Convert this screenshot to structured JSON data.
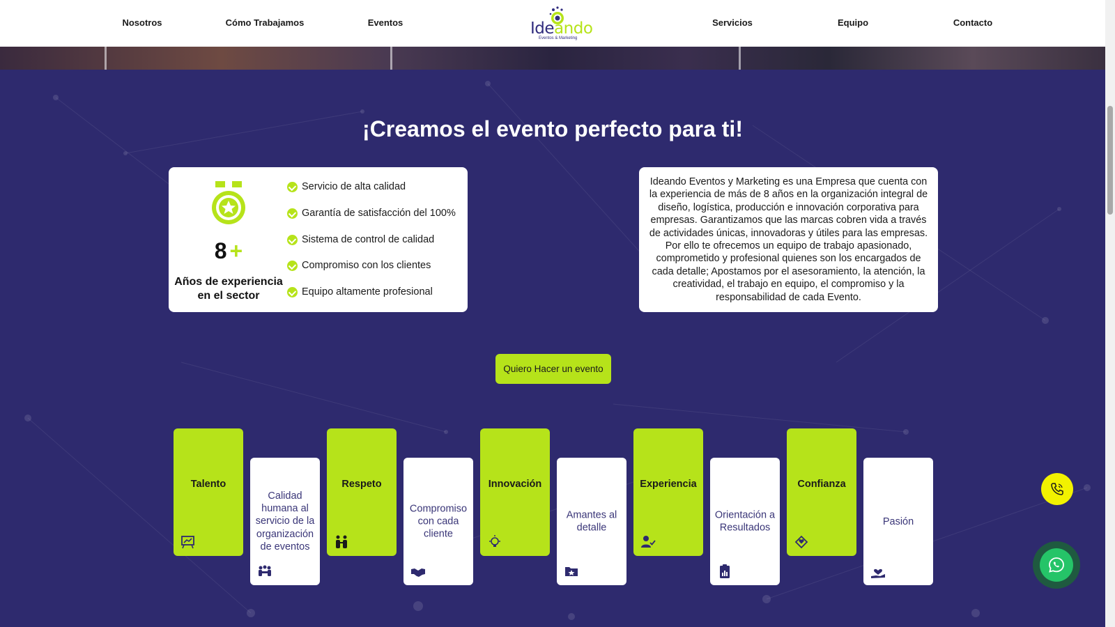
{
  "nav": {
    "left": [
      "Nosotros",
      "Cómo Trabajamos",
      "Eventos"
    ],
    "right": [
      "Servicios",
      "Equipo",
      "Contacto"
    ]
  },
  "logo": {
    "name_part1": "Ide",
    "name_part2": "ando",
    "tagline": "Eventos & Marketing"
  },
  "hero": {
    "title": "¡Creamos el evento perfecto para ti!",
    "experience_number": "8",
    "experience_plus": "+",
    "experience_label": "Años de experiencia en el sector",
    "features": [
      "Servicio de alta calidad",
      "Garantía de satisfacción del 100%",
      "Sistema de control de calidad",
      "Compromiso con los clientes",
      "Equipo altamente profesional"
    ],
    "about": "Ideando Eventos y Marketing es una Empresa que cuenta con la experiencia de más de 8 años en la organización integral de diseño, logística, producción e innovación corporativa para empresas. Garantizamos que las marcas cobren vida a través de actividades únicas, innovadoras y útiles para las empresas. Por ello te ofrecemos un equipo de trabajo apasionado, comprometido y profesional quienes son los encargados de cada detalle; Apostamos por el asesoramiento, la atención, la creatividad, el trabajo en equipo, el compromiso y la responsabilidad de cada Evento.",
    "cta_label": "Quiero Hacer un evento"
  },
  "values": [
    {
      "label": "Talento",
      "style": "green",
      "icon": "presentation-icon"
    },
    {
      "label": "Calidad humana al servicio de la organización de eventos",
      "style": "white",
      "icon": "team-meeting-icon"
    },
    {
      "label": "Respeto",
      "style": "green",
      "icon": "people-icon"
    },
    {
      "label": "Compromiso con cada cliente",
      "style": "white",
      "icon": "handshake-icon"
    },
    {
      "label": "Innovación",
      "style": "green",
      "icon": "lightbulb-icon"
    },
    {
      "label": "Amantes al detalle",
      "style": "white",
      "icon": "star-folder-icon"
    },
    {
      "label": "Experiencia",
      "style": "green",
      "icon": "user-check-icon"
    },
    {
      "label": "Orientación a Resultados",
      "style": "white",
      "icon": "clipboard-chart-icon"
    },
    {
      "label": "Confianza",
      "style": "green",
      "icon": "hands-heart-icon"
    },
    {
      "label": "Pasión",
      "style": "white",
      "icon": "heart-hand-icon"
    }
  ],
  "colors": {
    "accent": "#b6e31a",
    "background": "#2e2a6e",
    "brand_text": "#302c7e"
  }
}
